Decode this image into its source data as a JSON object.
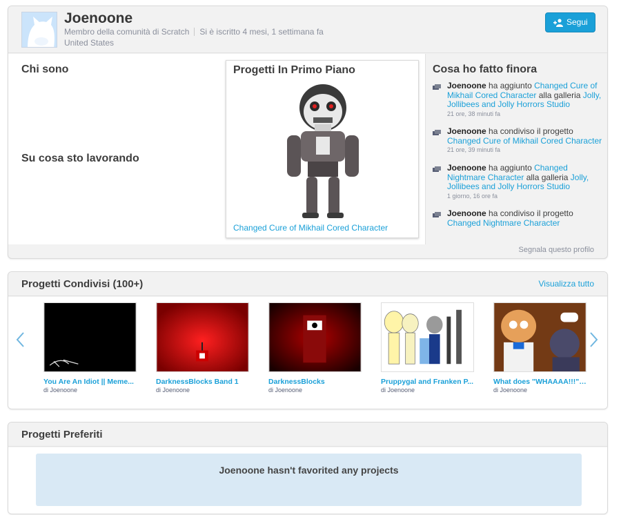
{
  "profile": {
    "username": "Joenoone",
    "membership": "Membro della comunità di Scratch",
    "joined": "Si è iscritto 4 mesi, 1 settimana fa",
    "country": "United States",
    "follow_label": "Segui",
    "about_title": "Chi sono",
    "working_title": "Su cosa sto lavorando",
    "featured_title": "Progetti In Primo Piano",
    "featured_project": "Changed Cure of Mikhail Cored Character",
    "activity_title": "Cosa ho fatto finora",
    "report_label": "Segnala questo profilo"
  },
  "activity": [
    {
      "user": "Joenoone",
      "verb": "ha aggiunto",
      "object": "Changed Cure of Mikhail Cored Character",
      "mid": "alla galleria",
      "target": "Jolly, Jollibees and Jolly Horrors Studio",
      "time": "21 ore, 38 minuti fa"
    },
    {
      "user": "Joenoone",
      "verb": "ha condiviso il progetto",
      "object": "Changed Cure of Mikhail Cored Character",
      "time": "21 ore, 39 minuti fa"
    },
    {
      "user": "Joenoone",
      "verb": "ha aggiunto",
      "object": "Changed Nightmare Character",
      "mid": "alla galleria",
      "target": "Jolly, Jollibees and Jolly Horrors Studio",
      "time": "1 giorno, 16 ore fa"
    },
    {
      "user": "Joenoone",
      "verb": "ha condiviso il progetto",
      "object": "Changed Nightmare Character"
    }
  ],
  "shared": {
    "title": "Progetti Condivisi (100+)",
    "view_all": "Visualizza tutto",
    "projects": [
      {
        "title": "You Are An Idiot || Meme...",
        "owner": "di Joenoone"
      },
      {
        "title": "DarknessBlocks Band 1",
        "owner": "di Joenoone"
      },
      {
        "title": "DarknessBlocks",
        "owner": "di Joenoone"
      },
      {
        "title": "Pruppygal and Franken P...",
        "owner": "di Joenoone"
      },
      {
        "title": "What does \"WHAAAA!!!\" ...",
        "owner": "di Joenoone"
      }
    ]
  },
  "favorites": {
    "title": "Progetti Preferiti",
    "empty_text": "Joenoone hasn't favorited any projects"
  },
  "colors": {
    "link": "#1aa0d8",
    "follow_button": "#1aa0d8",
    "empty_panel": "#d9e9f5"
  }
}
